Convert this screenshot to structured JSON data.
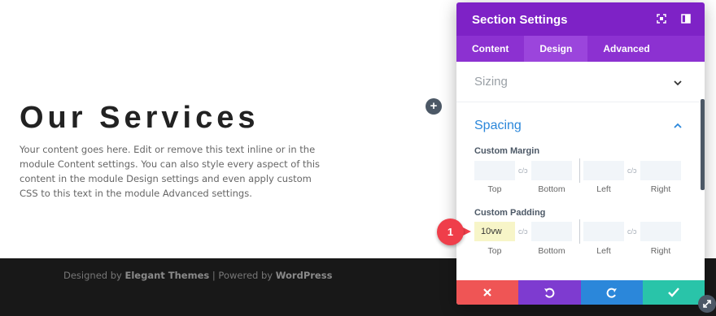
{
  "page": {
    "heading": "Our Services",
    "body": "Your content goes here. Edit or remove this text inline or in the module Content settings. You can also style every aspect of this content in the module Design settings and even apply custom CSS to this text in the module Advanced settings.",
    "footer": {
      "prefix": "Designed by ",
      "brand1": "Elegant Themes",
      "mid": " | Powered by ",
      "brand2": "WordPress"
    }
  },
  "panel": {
    "title": "Section Settings",
    "tabs": [
      "Content",
      "Design",
      "Advanced"
    ],
    "active_tab": "Design",
    "sections": {
      "sizing": "Sizing",
      "spacing": "Spacing"
    },
    "margin": {
      "label": "Custom Margin",
      "fields": [
        "Top",
        "Bottom",
        "Left",
        "Right"
      ],
      "values": [
        "",
        "",
        "",
        ""
      ]
    },
    "padding": {
      "label": "Custom Padding",
      "fields": [
        "Top",
        "Bottom",
        "Left",
        "Right"
      ],
      "values": [
        "10vw",
        "",
        "",
        ""
      ]
    },
    "footer_buttons": [
      {
        "name": "cancel",
        "color": "#ef5555"
      },
      {
        "name": "undo",
        "color": "#7e3bd0"
      },
      {
        "name": "redo",
        "color": "#2b87da"
      },
      {
        "name": "save",
        "color": "#29c4a9"
      }
    ]
  },
  "annotation": {
    "badge": "1"
  },
  "colors": {
    "header": "#7e22c6",
    "tabs": "#8c31d1",
    "accent": "#2b87da",
    "highlight": "#f7f5c8",
    "footer_bg": "#181818"
  }
}
